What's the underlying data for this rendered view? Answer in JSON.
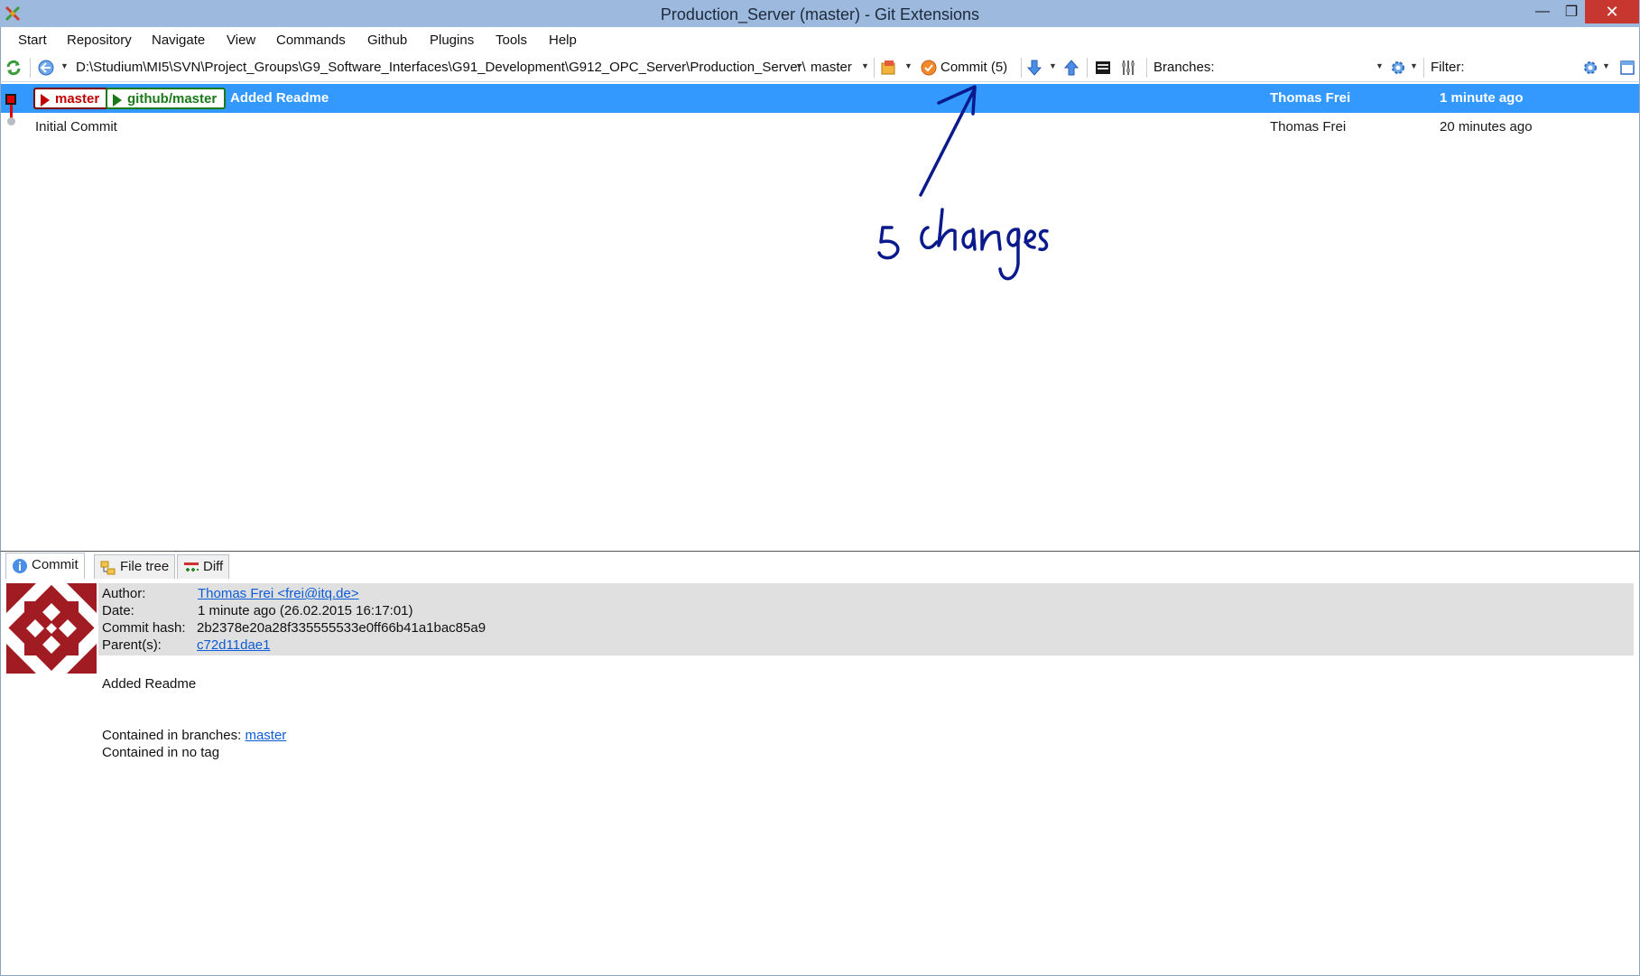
{
  "window": {
    "title": "Production_Server (master) - Git Extensions",
    "minimize": "—",
    "maximize": "❐",
    "close": "✕"
  },
  "menu": {
    "items": [
      "Start",
      "Repository",
      "Navigate",
      "View",
      "Commands",
      "Github",
      "Plugins",
      "Tools",
      "Help"
    ]
  },
  "toolbar": {
    "path": "D:\\Studium\\MI5\\SVN\\Project_Groups\\G9_Software_Interfaces\\G91_Development\\G912_OPC_Server\\Production_Server\\",
    "branch": "master",
    "commit_label": "Commit (5)",
    "branches_label": "Branches:",
    "branches_value": "",
    "filter_label": "Filter:",
    "filter_value": "",
    "icons": [
      "refresh-icon",
      "back-icon",
      "stash-icon",
      "commit-status-icon",
      "pull-icon",
      "push-icon",
      "console-icon",
      "settings-tools-icon",
      "branches-settings-icon",
      "filter-settings-icon",
      "layout-icon"
    ]
  },
  "commits": [
    {
      "message": "Added Readme",
      "author": "Thomas Frei",
      "date": "1 minute ago",
      "refs": [
        "master",
        "github/master"
      ],
      "selected": true
    },
    {
      "message": "Initial Commit",
      "author": "Thomas Frei",
      "date": "20 minutes ago",
      "refs": [],
      "selected": false
    }
  ],
  "annotation": {
    "text": "5 changes",
    "color": "#0a1a8c"
  },
  "tabs": [
    "Commit",
    "File tree",
    "Diff"
  ],
  "details": {
    "author_label": "Author:",
    "author_value": "Thomas Frei <frei@itq.de>",
    "date_label": "Date:",
    "date_value": "1 minute ago (26.02.2015 16:17:01)",
    "hash_label": "Commit hash:",
    "hash_value": "2b2378e20a28f335555533e0ff66b41a1bac85a9",
    "parents_label": "Parent(s):",
    "parents_value": "c72d11dae1",
    "message": "Added Readme",
    "branches_prefix": "Contained in branches:",
    "branches_link": "master",
    "tags_text": "Contained in no tag"
  },
  "colors": {
    "titlebar": "#9db9dd",
    "selection": "#3399ff",
    "master_ref": "#c00000",
    "remote_ref": "#1a7a1a",
    "link": "#0b5cd6",
    "close_button": "#c7372f"
  }
}
